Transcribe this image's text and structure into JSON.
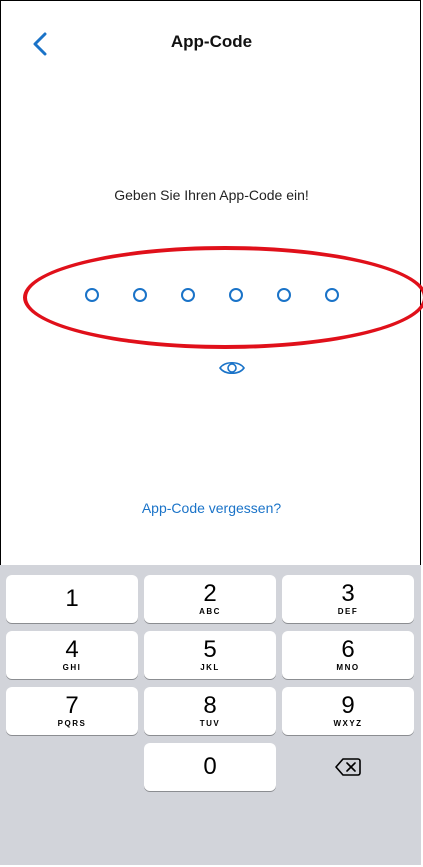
{
  "header": {
    "title": "App-Code"
  },
  "prompt": "Geben Sie Ihren App-Code ein!",
  "code": {
    "length": 6
  },
  "forgot_link": "App-Code vergessen?",
  "keypad": {
    "keys": [
      {
        "num": "1",
        "letters": ""
      },
      {
        "num": "2",
        "letters": "ABC"
      },
      {
        "num": "3",
        "letters": "DEF"
      },
      {
        "num": "4",
        "letters": "GHI"
      },
      {
        "num": "5",
        "letters": "JKL"
      },
      {
        "num": "6",
        "letters": "MNO"
      },
      {
        "num": "7",
        "letters": "PQRS"
      },
      {
        "num": "8",
        "letters": "TUV"
      },
      {
        "num": "9",
        "letters": "WXYZ"
      },
      {
        "num": "0",
        "letters": ""
      }
    ]
  },
  "icons": {
    "back": "chevron-left-icon",
    "eye": "eye-icon",
    "delete": "backspace-icon"
  },
  "colors": {
    "accent": "#1a73c8",
    "highlight": "#e0101a",
    "keyboard_bg": "#d2d4da"
  }
}
